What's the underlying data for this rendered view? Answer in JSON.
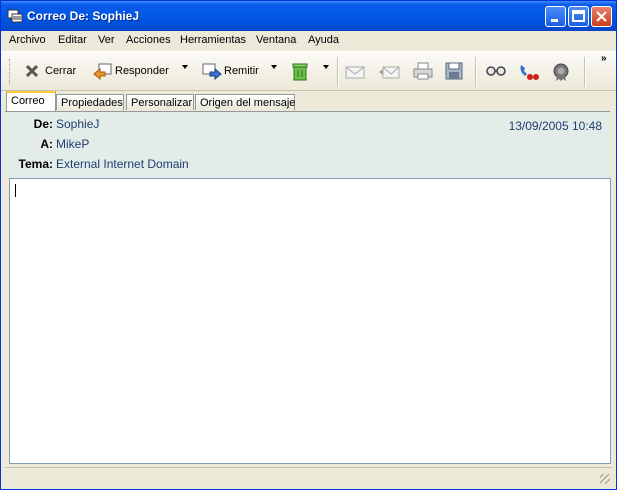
{
  "window": {
    "title": "Correo De:  SophieJ",
    "icon": "mail-window-icon",
    "controls": [
      "minimize-icon",
      "maximize-icon",
      "close-icon"
    ]
  },
  "menu": {
    "items": [
      "Archivo",
      "Editar",
      "Ver",
      "Acciones",
      "Herramientas",
      "Ventana",
      "Ayuda"
    ]
  },
  "toolbar": {
    "close_label": "Cerrar",
    "reply_label": "Responder",
    "forward_label": "Remitir",
    "overflow": "»",
    "icons": [
      "close-x-icon",
      "reply-icon",
      "forward-icon",
      "trash-icon",
      "mail-read-icon",
      "mail-back-icon",
      "print-icon",
      "save-icon",
      "glasses-icon",
      "telephone-icon",
      "seal-icon"
    ]
  },
  "tabs": [
    "Correo",
    "Propiedades",
    "Personalizar",
    "Origen del mensaje"
  ],
  "header": {
    "from_label": "De:",
    "from_value": "SophieJ",
    "to_label": "A:",
    "to_value": "MikeP",
    "subject_label": "Tema:",
    "subject_value": "External Internet Domain",
    "datetime": "13/09/2005 10:48"
  },
  "colors": {
    "titlebar": "#0058e6",
    "header_bg": "#e4ecea",
    "header_value_text": "#1c3e6e",
    "active_tab_accent": "#ffc83c"
  }
}
